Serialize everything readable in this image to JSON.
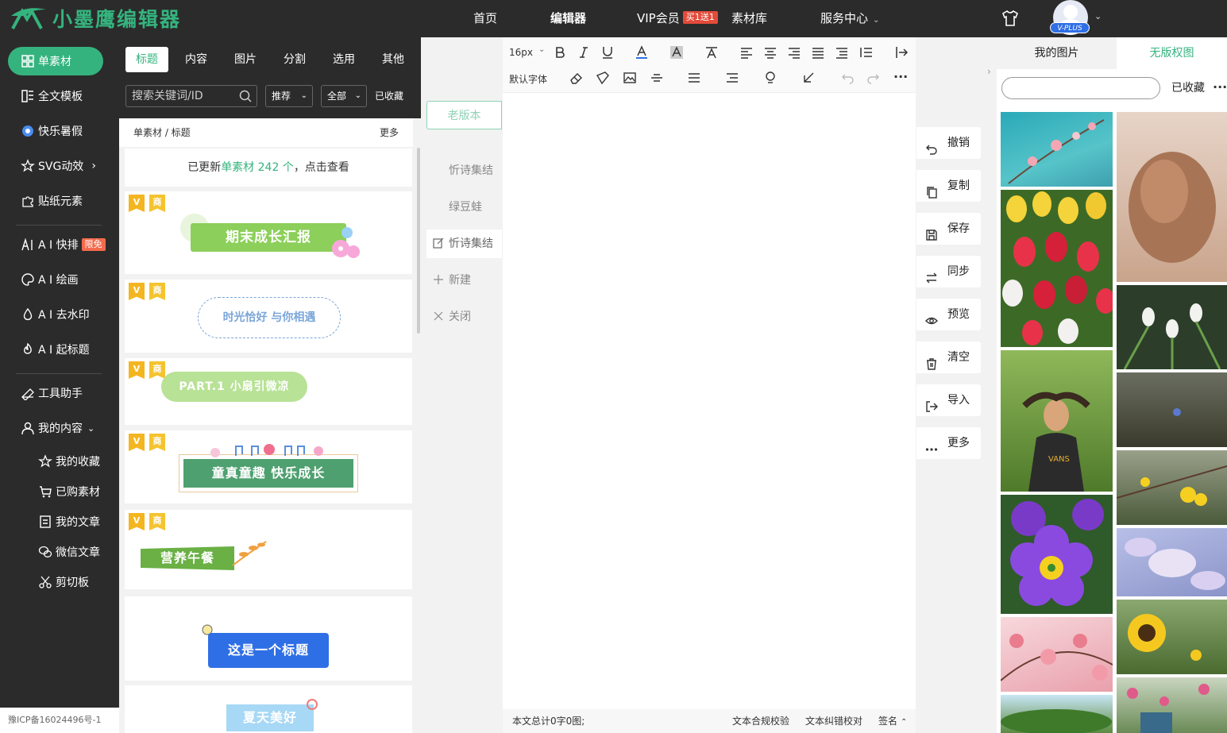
{
  "brand": {
    "name": "小墨鹰编辑器"
  },
  "nav": {
    "home": "首页",
    "editor": "编辑器",
    "vip": "VIP会员",
    "vip_badge": "买1送1",
    "library": "素材库",
    "service": "服务中心"
  },
  "user": {
    "plan_badge": "V-PLUS"
  },
  "sidebar": {
    "items": [
      {
        "label": "单素材"
      },
      {
        "label": "全文模板"
      },
      {
        "label": "快乐暑假"
      },
      {
        "label": "SVG动效"
      },
      {
        "label": "贴纸元素"
      },
      {
        "label": "A I 快排",
        "badge": "限免"
      },
      {
        "label": "A I 绘画"
      },
      {
        "label": "A I 去水印"
      },
      {
        "label": "A I 起标题"
      },
      {
        "label": "工具助手"
      },
      {
        "label": "我的内容"
      },
      {
        "label": "我的收藏"
      },
      {
        "label": "已购素材"
      },
      {
        "label": "我的文章"
      },
      {
        "label": "微信文章"
      },
      {
        "label": "剪切板"
      }
    ],
    "icp": "豫ICP备16024496号-1"
  },
  "material": {
    "tabs": [
      "标题",
      "内容",
      "图片",
      "分割",
      "选用",
      "其他"
    ],
    "search_placeholder": "搜索关键词/ID",
    "sort": "推荐",
    "filter": "全部",
    "favorites": "已收藏",
    "breadcrumb": "单素材 / 标题",
    "more": "更多",
    "update": {
      "prefix": "已更新",
      "highlight": "单素材 242 个",
      "suffix": "，点击查看"
    },
    "tag_v": "V",
    "tag_s": "商",
    "titles": [
      "期末成长汇报",
      "时光恰好 与你相遇",
      "PART.1   小扇引微凉",
      "童真童趣 快乐成长",
      "营养午餐",
      "这是一个标题",
      "夏天美好"
    ]
  },
  "versions": {
    "old": "老版本",
    "items": [
      "忻诗集结",
      "绿豆蛙",
      "忻诗集结"
    ],
    "new": "新建",
    "close": "关闭"
  },
  "editor": {
    "font_size": "16px",
    "font_family": "默认字体",
    "word_count": "本文总计0字0图;",
    "compliance": "文本合规校验",
    "correction": "文本纠错校对",
    "signature": "签名"
  },
  "actions": [
    "撤销",
    "复制",
    "保存",
    "同步",
    "预览",
    "清空",
    "导入",
    "更多"
  ],
  "images_panel": {
    "tab_mine": "我的图片",
    "tab_free": "无版权图",
    "favorites": "已收藏",
    "more": "···"
  },
  "colors": {
    "accent": "#35b37e",
    "dark": "#2b2b2b"
  }
}
